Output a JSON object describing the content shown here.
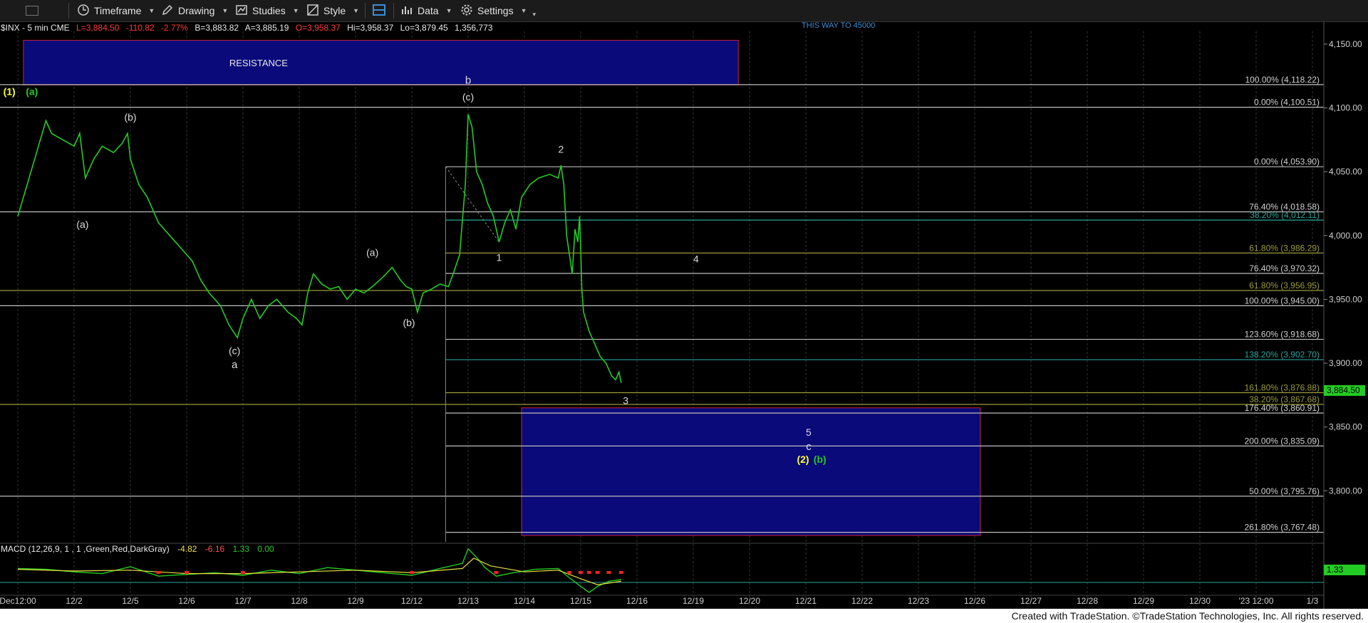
{
  "toolbar": {
    "timeframe_label": "Timeframe",
    "drawing_label": "Drawing",
    "studies_label": "Studies",
    "style_label": "Style",
    "data_label": "Data",
    "settings_label": "Settings"
  },
  "quote": {
    "symbol": "$INX - 5 min  CME",
    "last": "L=3,884.50",
    "change": "-110.82",
    "change_pct": "-2.77%",
    "bid": "B=3,883.82",
    "ask": "A=3,885.19",
    "open": "O=3,958.37",
    "high": "Hi=3,958.37",
    "low": "Lo=3,879.45",
    "volume": "1,356,773"
  },
  "last_price_tag": "3,884.50",
  "macd": {
    "label": "MACD (12,26,9, 1 , 1 ,Green,Red,DarkGray)",
    "v1": "-4.82",
    "v2": "-6.16",
    "v3": "1.33",
    "v4": "0.00",
    "tag": "1.33"
  },
  "footer": "Created with TradeStation. ©TradeStation Technologies, Inc. All rights reserved.",
  "colors": {
    "price": "#22cc22",
    "fib_line": "#bdbdbd",
    "fib_teal": "#2aa39a",
    "fib_olive": "#9a9a3a",
    "box_fill": "#0a0a7a",
    "box_border": "#cc2233",
    "axis_text": "#cfcfcf"
  },
  "chart_data": {
    "type": "line",
    "title": "$INX - 5 min",
    "xlabel": "",
    "ylabel": "",
    "ylim": [
      3760,
      4160
    ],
    "grid": true,
    "x_ticks": [
      "Dec12:00",
      "12/2",
      "12/5",
      "12/6",
      "12/7",
      "12/8",
      "12/9",
      "12/12",
      "12/13",
      "12/14",
      "12/15",
      "12/16",
      "12/19",
      "12/20",
      "12/21",
      "12/22",
      "12/23",
      "12/26",
      "12/27",
      "12/28",
      "12/29",
      "12/30",
      "'23 12:00",
      "1/3"
    ],
    "y_ticks": [
      3800,
      3850,
      3900,
      3950,
      4000,
      4050,
      4100,
      4150
    ],
    "y_tick_labels": [
      "3,800.00",
      "3,850.00",
      "3,900.00",
      "3,950.00",
      "4,000.00",
      "4,050.00",
      "4,100.00",
      "4,150.00"
    ],
    "series": [
      {
        "values": [
          [
            0,
            4015
          ],
          [
            0.3,
            4060
          ],
          [
            0.5,
            4090
          ],
          [
            0.6,
            4080
          ],
          [
            0.8,
            4075
          ],
          [
            1.0,
            4070
          ],
          [
            1.1,
            4080
          ],
          [
            1.2,
            4045
          ],
          [
            1.35,
            4060
          ],
          [
            1.5,
            4070
          ],
          [
            1.7,
            4065
          ],
          [
            1.85,
            4072
          ],
          [
            1.95,
            4080
          ],
          [
            2.0,
            4060
          ],
          [
            2.15,
            4040
          ],
          [
            2.3,
            4030
          ],
          [
            2.5,
            4010
          ],
          [
            2.7,
            4000
          ],
          [
            2.9,
            3990
          ],
          [
            3.1,
            3980
          ],
          [
            3.25,
            3965
          ],
          [
            3.4,
            3955
          ],
          [
            3.6,
            3945
          ],
          [
            3.75,
            3930
          ],
          [
            3.9,
            3920
          ],
          [
            4.0,
            3935
          ],
          [
            4.15,
            3950
          ],
          [
            4.3,
            3935
          ],
          [
            4.45,
            3945
          ],
          [
            4.6,
            3950
          ],
          [
            4.8,
            3940
          ],
          [
            4.95,
            3935
          ],
          [
            5.05,
            3930
          ],
          [
            5.15,
            3955
          ],
          [
            5.25,
            3970
          ],
          [
            5.4,
            3962
          ],
          [
            5.55,
            3958
          ],
          [
            5.7,
            3960
          ],
          [
            5.85,
            3950
          ],
          [
            6.0,
            3958
          ],
          [
            6.15,
            3955
          ],
          [
            6.3,
            3960
          ],
          [
            6.5,
            3968
          ],
          [
            6.65,
            3975
          ],
          [
            6.8,
            3965
          ],
          [
            6.9,
            3960
          ],
          [
            7.0,
            3958
          ],
          [
            7.1,
            3940
          ],
          [
            7.2,
            3955
          ],
          [
            7.35,
            3958
          ],
          [
            7.5,
            3962
          ],
          [
            7.65,
            3960
          ],
          [
            7.75,
            3972
          ],
          [
            7.85,
            3985
          ],
          [
            7.95,
            4040
          ],
          [
            8.0,
            4095
          ],
          [
            8.07,
            4085
          ],
          [
            8.15,
            4050
          ],
          [
            8.25,
            4040
          ],
          [
            8.35,
            4025
          ],
          [
            8.45,
            4015
          ],
          [
            8.55,
            3995
          ],
          [
            8.65,
            4010
          ],
          [
            8.75,
            4020
          ],
          [
            8.85,
            4005
          ],
          [
            8.95,
            4030
          ],
          [
            9.1,
            4040
          ],
          [
            9.25,
            4045
          ],
          [
            9.45,
            4048
          ],
          [
            9.6,
            4045
          ],
          [
            9.65,
            4055
          ],
          [
            9.7,
            4040
          ],
          [
            9.75,
            4000
          ],
          [
            9.8,
            3985
          ],
          [
            9.85,
            3970
          ],
          [
            9.9,
            4005
          ],
          [
            9.95,
            3995
          ],
          [
            9.98,
            4015
          ],
          [
            10.0,
            3990
          ],
          [
            10.02,
            3958
          ],
          [
            10.05,
            3940
          ],
          [
            10.15,
            3925
          ],
          [
            10.25,
            3915
          ],
          [
            10.35,
            3905
          ],
          [
            10.45,
            3900
          ],
          [
            10.55,
            3890
          ],
          [
            10.62,
            3887
          ],
          [
            10.68,
            3893
          ],
          [
            10.72,
            3884.5
          ]
        ]
      }
    ],
    "fib_levels": [
      {
        "label": "100.00% (4,118.22)",
        "value": 4118.22
      },
      {
        "label": "0.00% (4,100.51)",
        "value": 4100.51
      },
      {
        "label": "0.00% (4,053.90)",
        "value": 4053.9
      },
      {
        "label": "76.40% (4,018.58)",
        "value": 4018.58
      },
      {
        "label": "38.20% (4,012.11)",
        "value": 4012.11
      },
      {
        "label": "61.80% (3,986.29)",
        "value": 3986.29
      },
      {
        "label": "76.40% (3,970.32)",
        "value": 3970.32
      },
      {
        "label": "61.80% (3,956.95)",
        "value": 3956.95
      },
      {
        "label": "100.00% (3,945.00)",
        "value": 3945.0
      },
      {
        "label": "123.60% (3,918.68)",
        "value": 3918.68
      },
      {
        "label": "138.20% (3,902.70)",
        "value": 3902.7
      },
      {
        "label": "161.80% (3,876.88)",
        "value": 3876.88
      },
      {
        "label": "38.20% (3,867.68)",
        "value": 3867.68
      },
      {
        "label": "176.40% (3,860.91)",
        "value": 3860.91
      },
      {
        "label": "200.00% (3,835.09)",
        "value": 3835.09
      },
      {
        "label": "50.00% (3,795.76)",
        "value": 3795.76
      },
      {
        "label": "261.80% (3,767.48)",
        "value": 3767.48
      }
    ],
    "zones": [
      {
        "label": "RESISTANCE",
        "from_x": 0.1,
        "to_x": 12.8,
        "from_y": 4118,
        "to_y": 4153
      },
      {
        "label": "",
        "from_x": 8.95,
        "to_x": 17.1,
        "from_y": 3765,
        "to_y": 3865
      }
    ],
    "wave_labels": [
      {
        "text": "(1)",
        "x": -0.15,
        "y": 4110,
        "color": "#ffff33"
      },
      {
        "text": "(a)",
        "x": 0.25,
        "y": 4110,
        "color": "#22cc22"
      },
      {
        "text": "(b)",
        "x": 2.0,
        "y": 4090,
        "color": "#dddddd"
      },
      {
        "text": "(a)",
        "x": 1.15,
        "y": 4006,
        "color": "#dddddd"
      },
      {
        "text": "(c)",
        "x": 3.85,
        "y": 3907,
        "color": "#dddddd"
      },
      {
        "text": "a",
        "x": 3.85,
        "y": 3896,
        "color": "#dddddd"
      },
      {
        "text": "(a)",
        "x": 6.3,
        "y": 3984,
        "color": "#dddddd"
      },
      {
        "text": "(b)",
        "x": 6.95,
        "y": 3929,
        "color": "#dddddd"
      },
      {
        "text": "b",
        "x": 8.0,
        "y": 4119,
        "color": "#dddddd"
      },
      {
        "text": "(c)",
        "x": 8.0,
        "y": 4106,
        "color": "#dddddd"
      },
      {
        "text": "1",
        "x": 8.55,
        "y": 3980,
        "color": "#dddddd"
      },
      {
        "text": "2",
        "x": 9.65,
        "y": 4065,
        "color": "#dddddd"
      },
      {
        "text": "4",
        "x": 12.05,
        "y": 3979,
        "color": "#dddddd"
      },
      {
        "text": "3",
        "x": 10.8,
        "y": 3868,
        "color": "#dddddd"
      },
      {
        "text": "5",
        "x": 14.05,
        "y": 3843,
        "color": "#dddddd"
      },
      {
        "text": "c",
        "x": 14.05,
        "y": 3832,
        "color": "#dddddd"
      },
      {
        "text": "(2)",
        "x": 13.95,
        "y": 3822,
        "color": "#ffff33"
      },
      {
        "text": "(b)",
        "x": 14.25,
        "y": 3822,
        "color": "#22cc22"
      }
    ],
    "top_cut_text": "THIS WAY TO 45000",
    "macd_series": [
      [
        0,
        0.3
      ],
      [
        0.5,
        0.2
      ],
      [
        1.0,
        -0.1
      ],
      [
        1.5,
        -0.3
      ],
      [
        2.0,
        0.5
      ],
      [
        2.5,
        -0.6
      ],
      [
        3.0,
        -0.4
      ],
      [
        3.5,
        -0.2
      ],
      [
        4.0,
        -0.5
      ],
      [
        4.5,
        0.1
      ],
      [
        5.0,
        -0.3
      ],
      [
        5.5,
        0.4
      ],
      [
        6.0,
        0.1
      ],
      [
        6.5,
        -0.2
      ],
      [
        7.0,
        -0.5
      ],
      [
        7.5,
        0.3
      ],
      [
        7.9,
        0.9
      ],
      [
        8.0,
        2.6
      ],
      [
        8.15,
        1.6
      ],
      [
        8.3,
        0.4
      ],
      [
        8.5,
        -0.6
      ],
      [
        8.8,
        -0.2
      ],
      [
        9.2,
        0.2
      ],
      [
        9.6,
        0.3
      ],
      [
        9.8,
        -0.8
      ],
      [
        10.0,
        -1.8
      ],
      [
        10.15,
        -2.5
      ],
      [
        10.3,
        -1.8
      ],
      [
        10.5,
        -1.2
      ],
      [
        10.72,
        -1.0
      ]
    ],
    "macd_signal": [
      [
        0,
        0.2
      ],
      [
        1.0,
        0.0
      ],
      [
        2.0,
        0.1
      ],
      [
        3.0,
        -0.3
      ],
      [
        4.0,
        -0.3
      ],
      [
        5.0,
        -0.1
      ],
      [
        6.0,
        0.1
      ],
      [
        7.0,
        -0.2
      ],
      [
        7.9,
        0.3
      ],
      [
        8.1,
        1.5
      ],
      [
        8.4,
        0.6
      ],
      [
        9.0,
        -0.1
      ],
      [
        9.6,
        0.1
      ],
      [
        10.0,
        -0.9
      ],
      [
        10.3,
        -1.6
      ],
      [
        10.72,
        -1.2
      ]
    ]
  }
}
